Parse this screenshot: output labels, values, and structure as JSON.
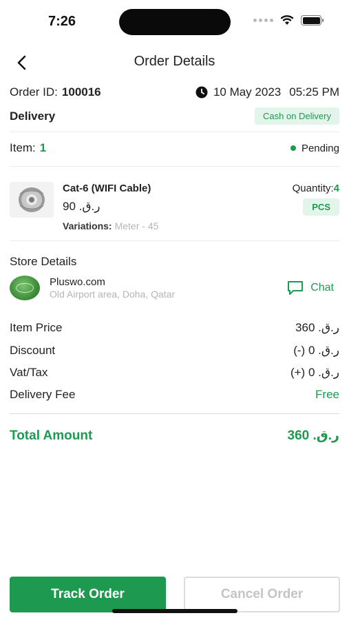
{
  "status_bar": {
    "time": "7:26"
  },
  "nav": {
    "title": "Order Details",
    "back_icon": "chevron-left-icon"
  },
  "order": {
    "id_label": "Order ID:",
    "id_value": "100016",
    "date": "10 May 2023",
    "time": "05:25 PM",
    "delivery_type": "Delivery",
    "payment_method": "Cash on Delivery",
    "item_label": "Item:",
    "item_count": "1",
    "status": "Pending"
  },
  "product": {
    "name": "Cat-6 (WIFI Cable)",
    "price": "ر.ق. 90",
    "variations_label": "Variations:",
    "variations_value": "Meter - 45",
    "quantity_label": "Quantity:",
    "quantity_value": "4",
    "unit": "PCS"
  },
  "store": {
    "section_title": "Store Details",
    "name": "Pluswo.com",
    "address": "Old Airport area, Doha, Qatar",
    "chat_label": "Chat"
  },
  "summary": {
    "item_price_label": "Item Price",
    "item_price_value": "ر.ق. 360",
    "discount_label": "Discount",
    "discount_value": "ر.ق. 0 (-)",
    "vat_label": "Vat/Tax",
    "vat_value": "ر.ق. 0 (+)",
    "delivery_fee_label": "Delivery Fee",
    "delivery_fee_value": "Free",
    "total_label": "Total Amount",
    "total_value": "ر.ق. 360"
  },
  "actions": {
    "track_label": "Track Order",
    "cancel_label": "Cancel Order"
  },
  "colors": {
    "accent": "#1d9a4f",
    "badge_bg": "#e3f4ea",
    "muted": "#b5b5b5"
  }
}
